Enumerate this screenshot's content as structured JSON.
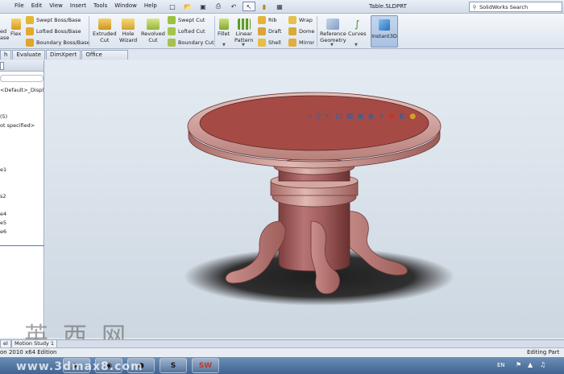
{
  "menus": [
    "File",
    "Edit",
    "View",
    "Insert",
    "Tools",
    "Window",
    "Help"
  ],
  "quick_access": [
    "new-document-icon",
    "open-icon",
    "save-icon",
    "print-icon",
    "undo-icon",
    "select-icon",
    "rebuild-icon",
    "options-icon"
  ],
  "document_title": "Table.SLDPRT",
  "search": {
    "placeholder": "SolidWorks Search"
  },
  "command_manager": {
    "cut_off_left": {
      "line1": "ed",
      "line2": "ase"
    },
    "flex": "Flex",
    "swept_boss": "Swept Boss/Base",
    "lofted_boss": "Lofted Boss/Base",
    "boundary_boss": "Boundary Boss/Base",
    "extruded_cut": {
      "line1": "Extruded",
      "line2": "Cut"
    },
    "hole_wizard": {
      "line1": "Hole",
      "line2": "Wizard"
    },
    "revolved_cut": {
      "line1": "Revolved",
      "line2": "Cut"
    },
    "swept_cut": "Swept Cut",
    "lofted_cut": "Lofted Cut",
    "boundary_cut": "Boundary Cut",
    "fillet": "Fillet",
    "linear_pattern": {
      "line1": "Linear",
      "line2": "Pattern"
    },
    "rib": "Rib",
    "draft": "Draft",
    "shell": "Shell",
    "wrap": "Wrap",
    "dome": "Dome",
    "mirror": "Mirror",
    "reference_geometry": {
      "line1": "Reference",
      "line2": "Geometry"
    },
    "curves": "Curves",
    "instant3d": "Instant3D"
  },
  "tabs": [
    "h",
    "Evaluate",
    "DimXpert",
    "Office Products"
  ],
  "feature_tree": {
    "display_state": "<Default>_Displ",
    "row_5": "(5)",
    "material": "ot specified>",
    "items": [
      "e1",
      "s2",
      "e4",
      "e5",
      "e6"
    ]
  },
  "bottom_tabs": [
    "el",
    "Motion Study 1"
  ],
  "status": {
    "left": "on 2010 x64 Edition",
    "right": "Editing Part"
  },
  "taskbar": {
    "language": "EN"
  },
  "watermark": {
    "chars": "英西网",
    "url": "www.3dmax8.com"
  },
  "colors": {
    "model_body": "#a35f5f",
    "model_top": "#a64a45",
    "model_rim": "#d7a9a4",
    "graphics_bg": "#d7e0e9",
    "accent": "#3a6fc4"
  }
}
